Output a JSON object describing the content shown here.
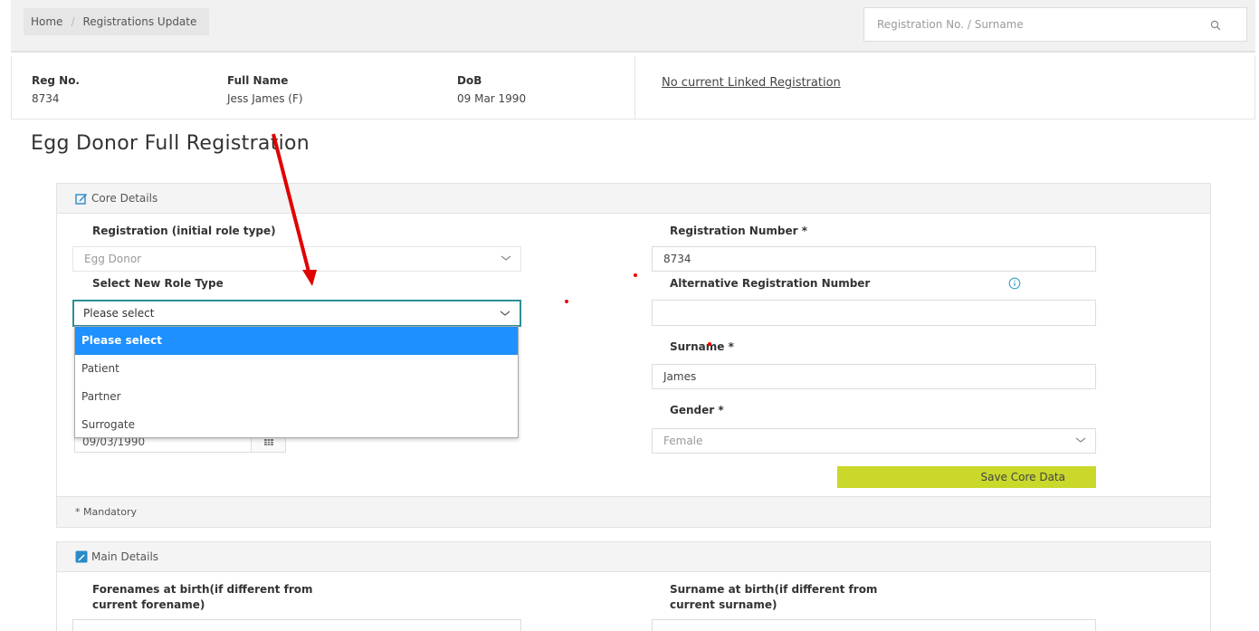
{
  "breadcrumb": {
    "home": "Home",
    "separator": "/",
    "current": "Registrations Update"
  },
  "search": {
    "placeholder": "Registration No. / Surname",
    "icon": "search-icon"
  },
  "summary": {
    "reg_no_label": "Reg No.",
    "reg_no": "8734",
    "full_name_label": "Full Name",
    "full_name": "Jess James (F)",
    "dob_label": "DoB",
    "dob": "09 Mar 1990",
    "linked": "No current Linked Registration"
  },
  "page_title": "Egg Donor Full Registration",
  "core": {
    "header": "Core Details",
    "registration_label": "Registration (initial role type)",
    "registration_value": "Egg Donor",
    "new_role_label": "Select New Role Type",
    "new_role_value": "Please select",
    "new_role_options": [
      "Please select",
      "Patient",
      "Partner",
      "Surrogate"
    ],
    "dob_value": "09/03/1990",
    "reg_number_label": "Registration Number *",
    "reg_number_value": "8734",
    "alt_reg_label": "Alternative Registration Number",
    "alt_reg_value": "",
    "surname_label": "Surname *",
    "surname_value": "James",
    "gender_label": "Gender *",
    "gender_value": "Female",
    "save_label": "Save Core Data",
    "mandatory_note": "* Mandatory"
  },
  "main": {
    "header": "Main Details",
    "forenames_label_1": "Forenames at birth(if different from",
    "forenames_label_2": "current forename)",
    "surname_birth_label_1": "Surname at birth(if different from",
    "surname_birth_label_2": "current surname)"
  },
  "colors": {
    "accent": "#1e90ff",
    "focus": "#2d8f95",
    "save_button": "#c9d82b",
    "annotation": "#e00000"
  }
}
